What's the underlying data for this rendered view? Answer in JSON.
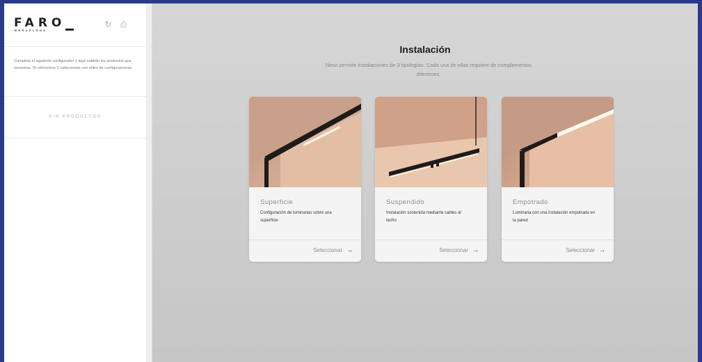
{
  "brand": {
    "logo_text": "FARO",
    "logo_sub": "BARCELONA"
  },
  "sidebar": {
    "intro": "Completa el siguiente configurador y aquí saldrán los productos que necesitas. Te ofrecemos 2 colecciones con miles de configuraciones.",
    "empty_label": "SIN PRODUCTOS",
    "icons": [
      "refresh-icon",
      "print-icon"
    ]
  },
  "main": {
    "title": "Instalación",
    "subtitle": "Neso permite instalaciones de 3 tipologías. Cada una de ellas requiere de complementos diferentes.",
    "cards": [
      {
        "title": "Superficie",
        "desc": "Configuración de luminarias sobre una superficie",
        "button": "Seleccionar"
      },
      {
        "title": "Suspendido",
        "desc": "Instalación sostenida mediante cables al techo",
        "button": "Seleccionar"
      },
      {
        "title": "Empotrado",
        "desc": "Luminaria con una instalación empotrada en la pared",
        "button": "Seleccionar"
      }
    ]
  },
  "colors": {
    "accent": "#c8a39d",
    "frame": "#2a3a8c"
  }
}
